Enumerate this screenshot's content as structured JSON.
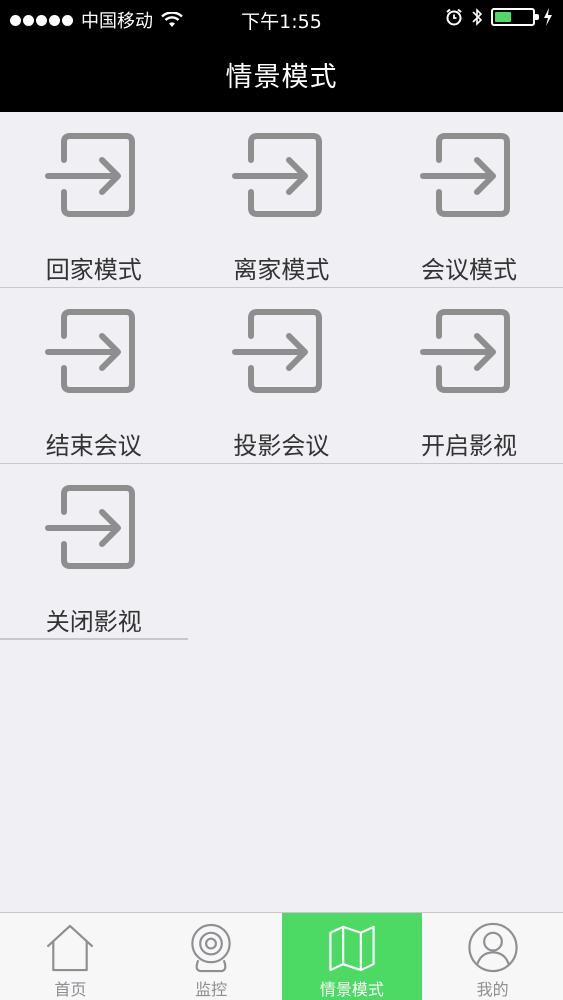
{
  "status_bar": {
    "carrier": "中国移动",
    "time": "下午1:55",
    "battery_level": 0.45,
    "battery_color": "#4cd964"
  },
  "nav": {
    "title": "情景模式"
  },
  "scenes": [
    {
      "label": "回家模式",
      "icon": "enter-icon"
    },
    {
      "label": "离家模式",
      "icon": "enter-icon"
    },
    {
      "label": "会议模式",
      "icon": "enter-icon"
    },
    {
      "label": "结束会议",
      "icon": "enter-icon"
    },
    {
      "label": "投影会议",
      "icon": "enter-icon"
    },
    {
      "label": "开启影视",
      "icon": "enter-icon"
    },
    {
      "label": "关闭影视",
      "icon": "enter-icon"
    }
  ],
  "tabs": [
    {
      "label": "首页",
      "icon": "home-icon",
      "active": false
    },
    {
      "label": "监控",
      "icon": "camera-icon",
      "active": false
    },
    {
      "label": "情景模式",
      "icon": "map-icon",
      "active": true
    },
    {
      "label": "我的",
      "icon": "user-icon",
      "active": false
    }
  ],
  "colors": {
    "accent": "#4cd964",
    "header_bg": "#000000",
    "page_bg": "#efeff4"
  }
}
